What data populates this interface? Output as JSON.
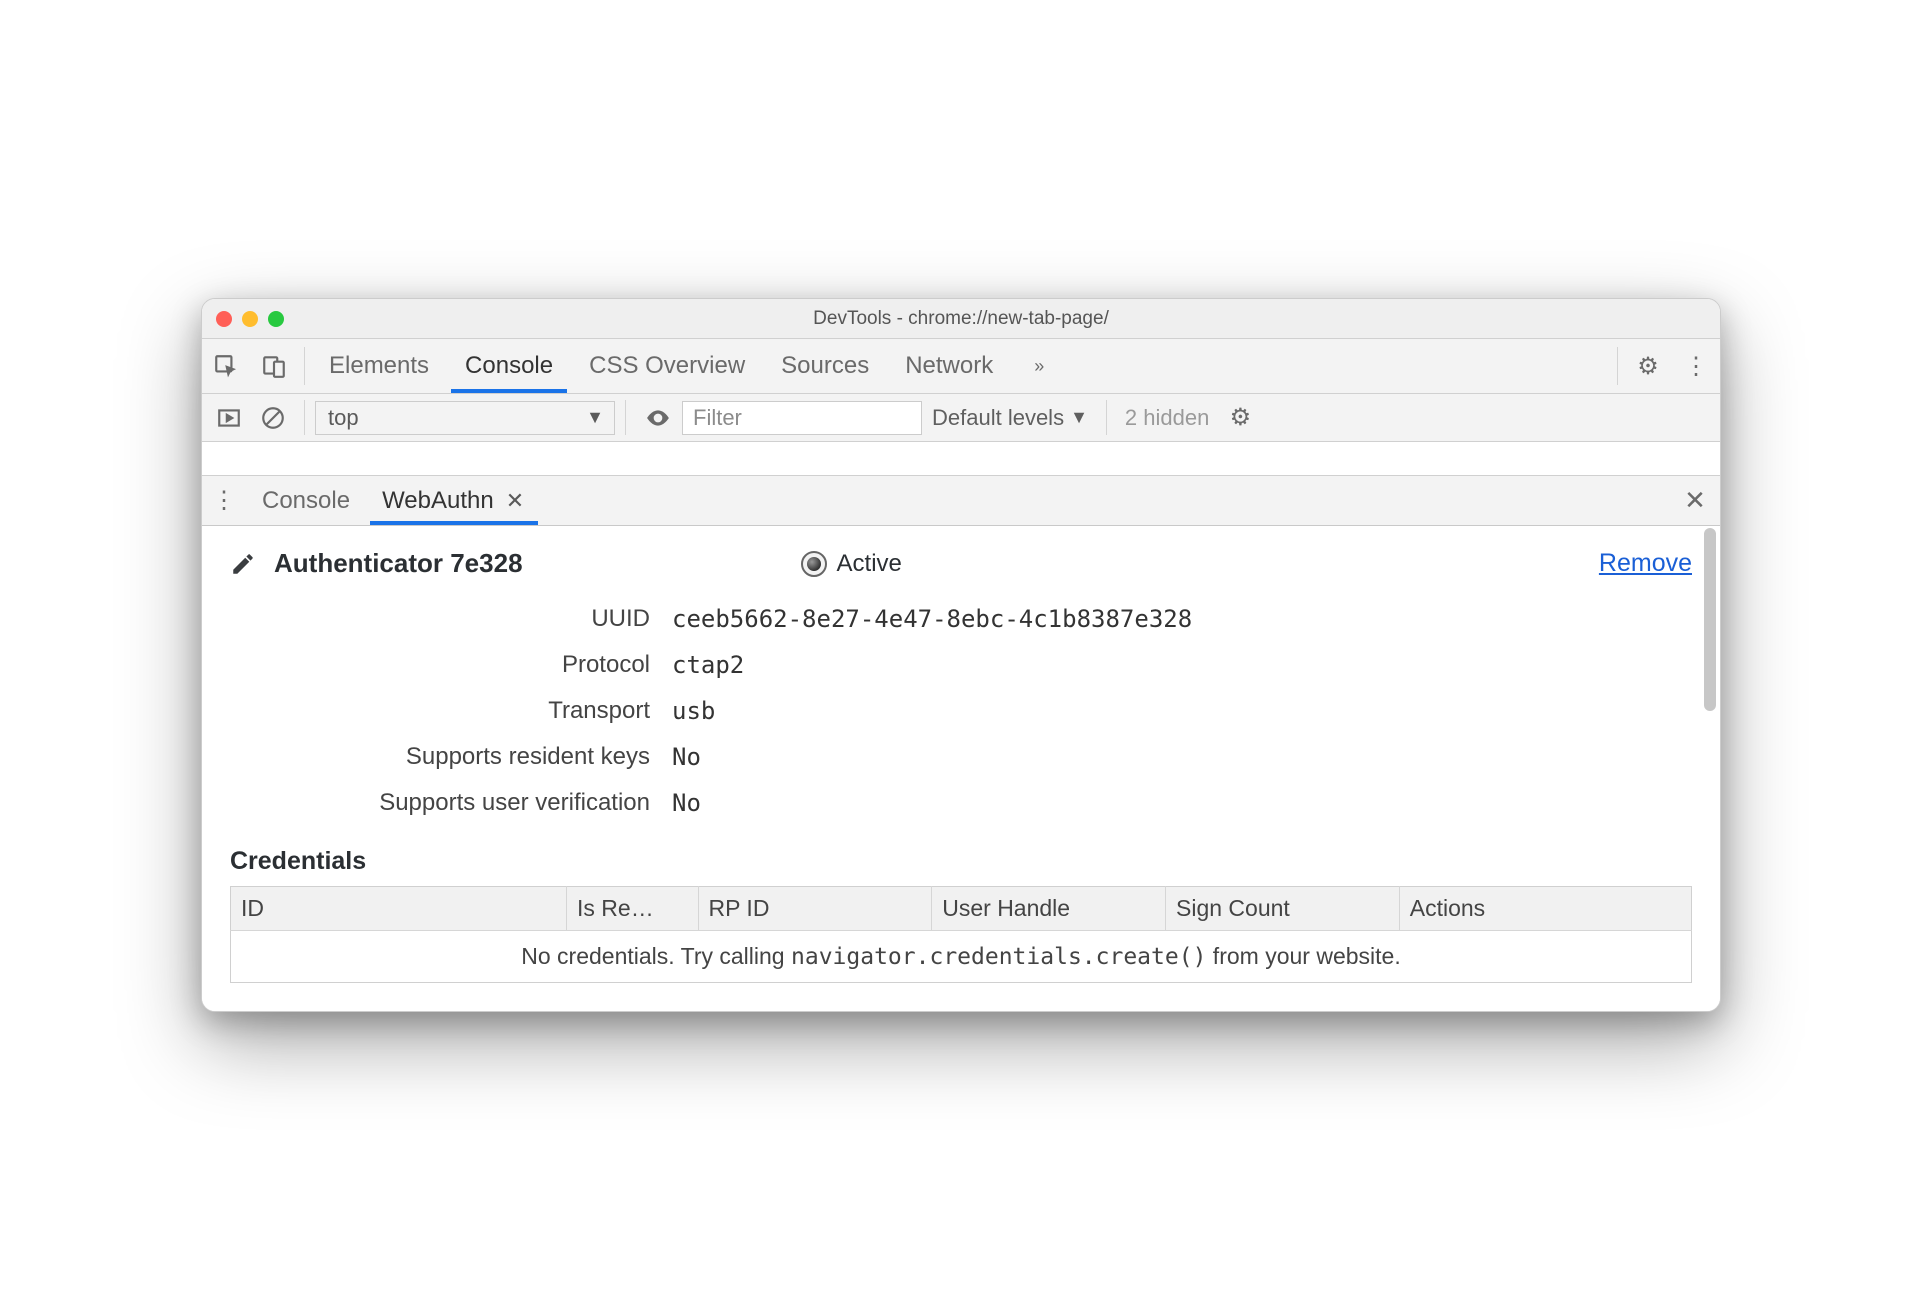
{
  "window": {
    "title": "DevTools - chrome://new-tab-page/"
  },
  "toolbar": {
    "tabs": [
      "Elements",
      "Console",
      "CSS Overview",
      "Sources",
      "Network"
    ],
    "active_tab": "Console"
  },
  "console_toolbar": {
    "context": "top",
    "filter_placeholder": "Filter",
    "levels": "Default levels",
    "hidden": "2 hidden"
  },
  "drawer": {
    "tabs": [
      "Console",
      "WebAuthn"
    ],
    "active_tab": "WebAuthn"
  },
  "authenticator": {
    "title": "Authenticator 7e328",
    "active_label": "Active",
    "remove_label": "Remove",
    "props": {
      "uuid_label": "UUID",
      "uuid": "ceeb5662-8e27-4e47-8ebc-4c1b8387e328",
      "protocol_label": "Protocol",
      "protocol": "ctap2",
      "transport_label": "Transport",
      "transport": "usb",
      "resident_label": "Supports resident keys",
      "resident": "No",
      "uv_label": "Supports user verification",
      "uv": "No"
    }
  },
  "credentials": {
    "heading": "Credentials",
    "columns": [
      "ID",
      "Is Re…",
      "RP ID",
      "User Handle",
      "Sign Count",
      "Actions"
    ],
    "empty_prefix": "No credentials. Try calling ",
    "empty_code": "navigator.credentials.create()",
    "empty_suffix": " from your website."
  }
}
